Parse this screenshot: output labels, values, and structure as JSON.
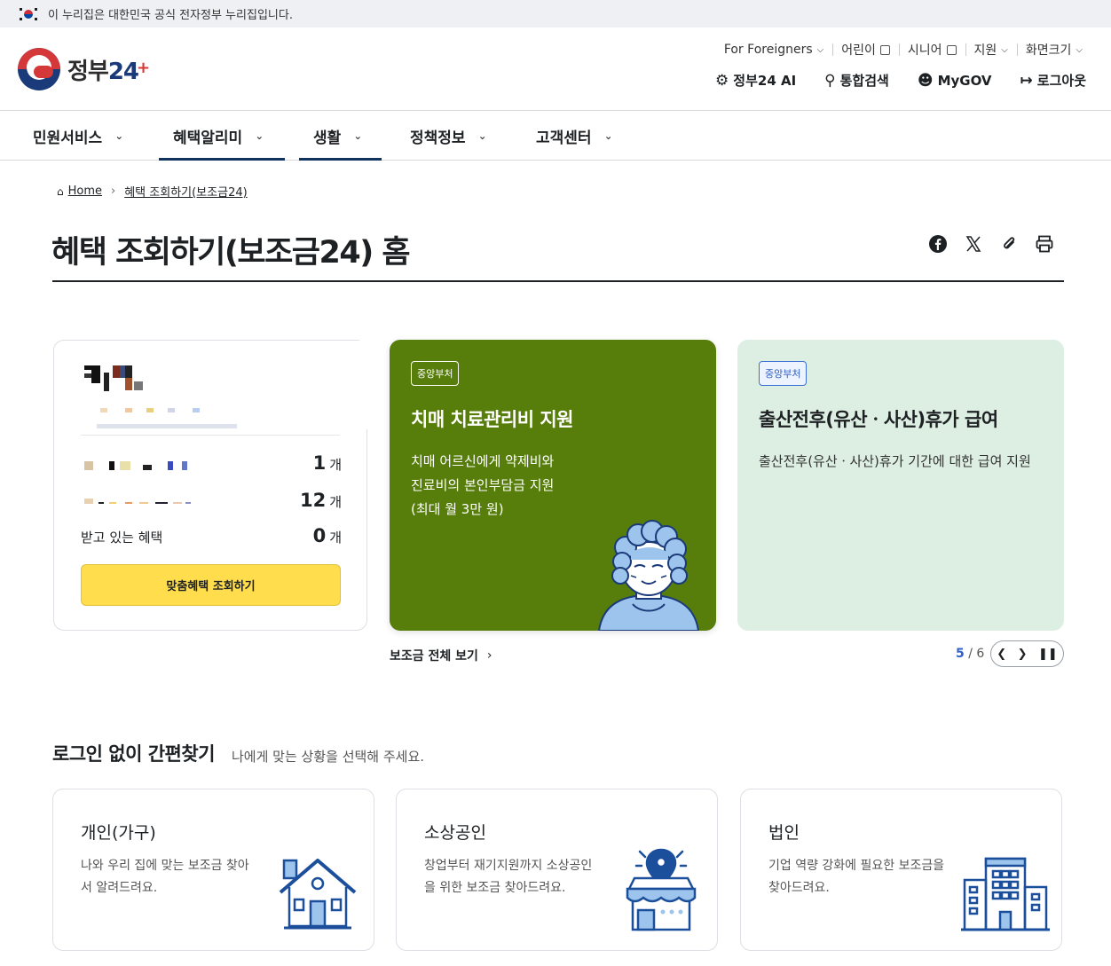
{
  "gov_banner": {
    "text": "이 누리집은 대한민국 공식 전자정부 누리집입니다."
  },
  "logo": {
    "text": "정부",
    "num": "24"
  },
  "util_nav": [
    {
      "label": "For Foreigners"
    },
    {
      "label": "어린이"
    },
    {
      "label": "시니어"
    },
    {
      "label": "지원"
    },
    {
      "label": "화면크기"
    }
  ],
  "main_util": [
    {
      "label": "정부24 AI"
    },
    {
      "label": "통합검색"
    },
    {
      "label": "MyGOV"
    },
    {
      "label": "로그아웃"
    }
  ],
  "gnb": [
    {
      "label": "민원서비스"
    },
    {
      "label": "혜택알리미"
    },
    {
      "label": "생활"
    },
    {
      "label": "정책정보"
    },
    {
      "label": "고객센터"
    }
  ],
  "breadcrumb": {
    "home": "Home",
    "current": "혜택 조회하기(보조금24)"
  },
  "page_title": "혜택 조회하기(보조금24) 홈",
  "user_card": {
    "rows": [
      {
        "label": "",
        "count": "1",
        "unit": "개"
      },
      {
        "label": "",
        "count": "12",
        "unit": "개"
      },
      {
        "label": "받고 있는 혜택",
        "count": "0",
        "unit": "개"
      }
    ],
    "button": "맞춤혜택 조회하기"
  },
  "benefit_cards": [
    {
      "tag": "중앙부처",
      "title": "치매 치료관리비 지원",
      "desc_lines": [
        "치매 어르신에게 약제비와",
        "진료비의 본인부담금 지원",
        "(최대 월 3만 원)"
      ]
    },
    {
      "tag": "중앙부처",
      "title": "출산전후(유산ㆍ사산)휴가 급여",
      "desc": "출산전후(유산ㆍ사산)휴가 기간에 대한 급여 지원"
    }
  ],
  "all_link": "보조금 전체 보기",
  "pager": {
    "current": "5",
    "total": "6"
  },
  "quick_find": {
    "title": "로그인 없이 간편찾기",
    "subtitle": "나에게 맞는 상황을 선택해 주세요.",
    "cards": [
      {
        "title": "개인(가구)",
        "desc": "나와 우리 집에 맞는 보조금 찾아서 알려드려요."
      },
      {
        "title": "소상공인",
        "desc": "창업부터 재기지원까지 소상공인을 위한 보조금 찾아드려요."
      },
      {
        "title": "법인",
        "desc": "기업 역량 강화에 필요한 보조금을 찾아드려요."
      }
    ]
  },
  "colors": {
    "primary": "#12325e",
    "green_card": "#577d0b",
    "mint_card": "#ddeee2",
    "yellow_button": "#ffdd4d",
    "pager_accent": "#2f5fc7"
  }
}
